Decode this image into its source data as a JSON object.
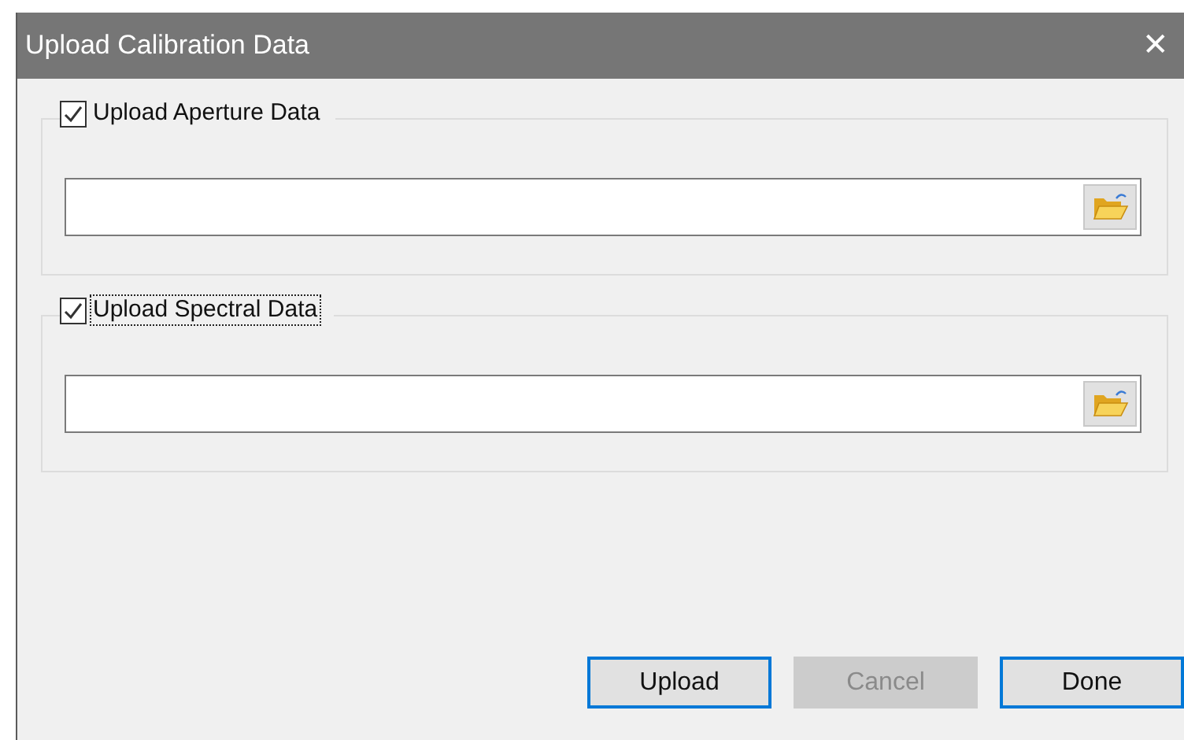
{
  "window": {
    "title": "Upload Calibration Data",
    "close": "✕"
  },
  "groups": [
    {
      "label": "Upload Aperture Data",
      "checked": true,
      "focused": false
    },
    {
      "label": "Upload Spectral Data",
      "checked": true,
      "focused": true
    }
  ],
  "buttons": [
    {
      "label": "Upload",
      "disabled": false,
      "highlighted": true
    },
    {
      "label": "Cancel",
      "disabled": true,
      "highlighted": false
    },
    {
      "label": "Done",
      "disabled": false,
      "highlighted": true
    }
  ]
}
